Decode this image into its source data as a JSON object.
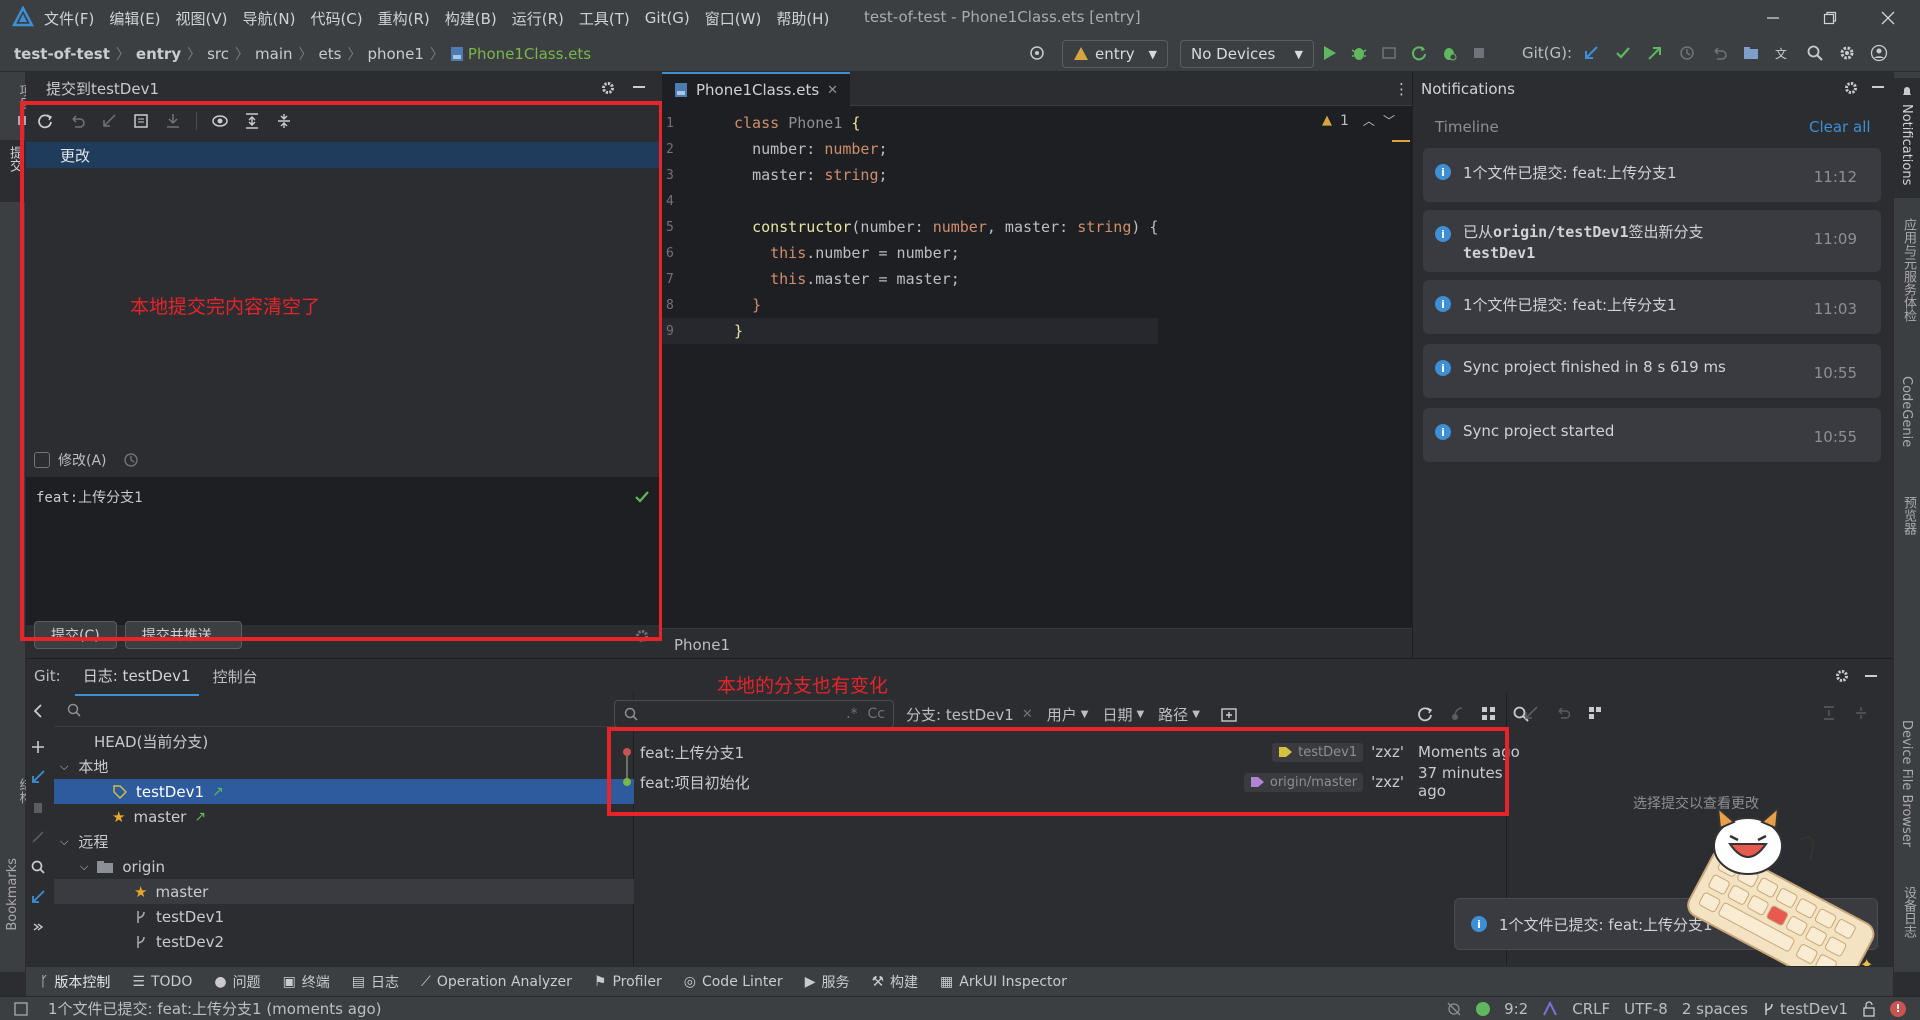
{
  "app": {
    "window_title": "test-of-test - Phone1Class.ets [entry]",
    "menu": [
      "文件(F)",
      "编辑(E)",
      "视图(V)",
      "导航(N)",
      "代码(C)",
      "重构(R)",
      "构建(B)",
      "运行(R)",
      "工具(T)",
      "Git(G)",
      "窗口(W)",
      "帮助(H)"
    ]
  },
  "nav": {
    "breadcrumbs": [
      "test-of-test",
      "entry",
      "src",
      "main",
      "ets",
      "phone1",
      "Phone1Class.ets"
    ],
    "module_combo": "entry",
    "device_combo": "No Devices",
    "git_label": "Git(G):"
  },
  "left_strip": {
    "top": "项目",
    "middle": "提交",
    "structure": "结构",
    "bookmarks": "Bookmarks"
  },
  "commit_panel": {
    "title": "提交到testDev1",
    "changes_label": "更改",
    "amend_label": "修改(A)",
    "message": "feat:上传分支1",
    "commit_button": "提交(C)",
    "commit_push_button": "提交并推送..."
  },
  "annotations": {
    "commit_cleared": "本地提交完内容清空了",
    "branch_changed": "本地的分支也有变化"
  },
  "editor": {
    "tab": "Phone1Class.ets",
    "warnings": "1",
    "footer": "Phone1",
    "lines": [
      {
        "n": "1",
        "indent": "",
        "parts": [
          [
            "kw",
            "class "
          ],
          [
            "cls",
            "Phone1 "
          ],
          [
            "fn",
            "{"
          ]
        ]
      },
      {
        "n": "2",
        "indent": "  ",
        "parts": [
          [
            "tx",
            "number"
          ],
          [
            "tx",
            ": "
          ],
          [
            "ty",
            "number"
          ],
          [
            "tx",
            ";"
          ]
        ]
      },
      {
        "n": "3",
        "indent": "  ",
        "parts": [
          [
            "tx",
            "master"
          ],
          [
            "tx",
            ": "
          ],
          [
            "ty",
            "string"
          ],
          [
            "tx",
            ";"
          ]
        ]
      },
      {
        "n": "4",
        "indent": "",
        "parts": []
      },
      {
        "n": "5",
        "indent": "  ",
        "parts": [
          [
            "fn",
            "constructor"
          ],
          [
            "tx",
            "(number: "
          ],
          [
            "ty",
            "number"
          ],
          [
            "tx",
            ", master: "
          ],
          [
            "ty",
            "string"
          ],
          [
            "tx",
            ") {"
          ]
        ]
      },
      {
        "n": "6",
        "indent": "    ",
        "parts": [
          [
            "kw",
            "this"
          ],
          [
            "tx",
            ".number = number;"
          ]
        ]
      },
      {
        "n": "7",
        "indent": "    ",
        "parts": [
          [
            "kw",
            "this"
          ],
          [
            "tx",
            ".master = master;"
          ]
        ]
      },
      {
        "n": "8",
        "indent": "  ",
        "parts": [
          [
            "kw",
            "}"
          ]
        ]
      },
      {
        "n": "9",
        "indent": "",
        "parts": [
          [
            "fn",
            "}"
          ]
        ]
      }
    ]
  },
  "notifications": {
    "title": "Notifications",
    "timeline": "Timeline",
    "clear_all": "Clear all",
    "items": [
      {
        "text": "1个文件已提交: feat:上传分支1",
        "time": "11:12"
      },
      {
        "text_a": "已从",
        "text_b": "origin/testDev1",
        "text_c": "签出新分支",
        "text_d": "testDev1",
        "time": "11:09"
      },
      {
        "text": "1个文件已提交: feat:上传分支1",
        "time": "11:03"
      },
      {
        "text": "Sync project finished in 8 s 619 ms",
        "time": "10:55"
      },
      {
        "text": "Sync project started",
        "time": "10:55"
      }
    ]
  },
  "right_strip": [
    "Notifications",
    "应用与元服务体检",
    "CodeGenie",
    "预览器",
    "Device File Browser",
    "设备日志"
  ],
  "git": {
    "label": "Git:",
    "tabs": [
      "日志: testDev1",
      "控制台"
    ],
    "tree": {
      "head": "HEAD(当前分支)",
      "local": "本地",
      "local_branches": [
        "testDev1",
        "master"
      ],
      "remote": "远程",
      "origin": "origin",
      "remote_branches": [
        "master",
        "testDev1",
        "testDev2"
      ]
    },
    "filters": {
      "branch": "分支: testDev1",
      "user": "用户",
      "date": "日期",
      "path": "路径"
    },
    "log": [
      {
        "msg": "feat:上传分支1",
        "ref": "testDev1",
        "author": "'zxz'",
        "when": "Moments ago",
        "dot": "#c75450",
        "tag_color": "#d6c13f"
      },
      {
        "msg": "feat:项目初始化",
        "ref": "origin/master",
        "author": "'zxz'",
        "when": "37 minutes ago",
        "dot": "#7ab648",
        "tag_color": "#b284d6"
      }
    ],
    "details_hint": "选择提交以查看更改",
    "toast": "1个文件已提交: feat:上传分支1"
  },
  "toolwindows": [
    "版本控制",
    "TODO",
    "问题",
    "终端",
    "日志",
    "Operation Analyzer",
    "Profiler",
    "Code Linter",
    "服务",
    "构建",
    "ArkUI Inspector"
  ],
  "status": {
    "message": "1个文件已提交: feat:上传分支1 (moments ago)",
    "position": "9:2",
    "line_sep": "CRLF",
    "encoding": "UTF-8",
    "indent": "2 spaces",
    "branch": "testDev1"
  }
}
